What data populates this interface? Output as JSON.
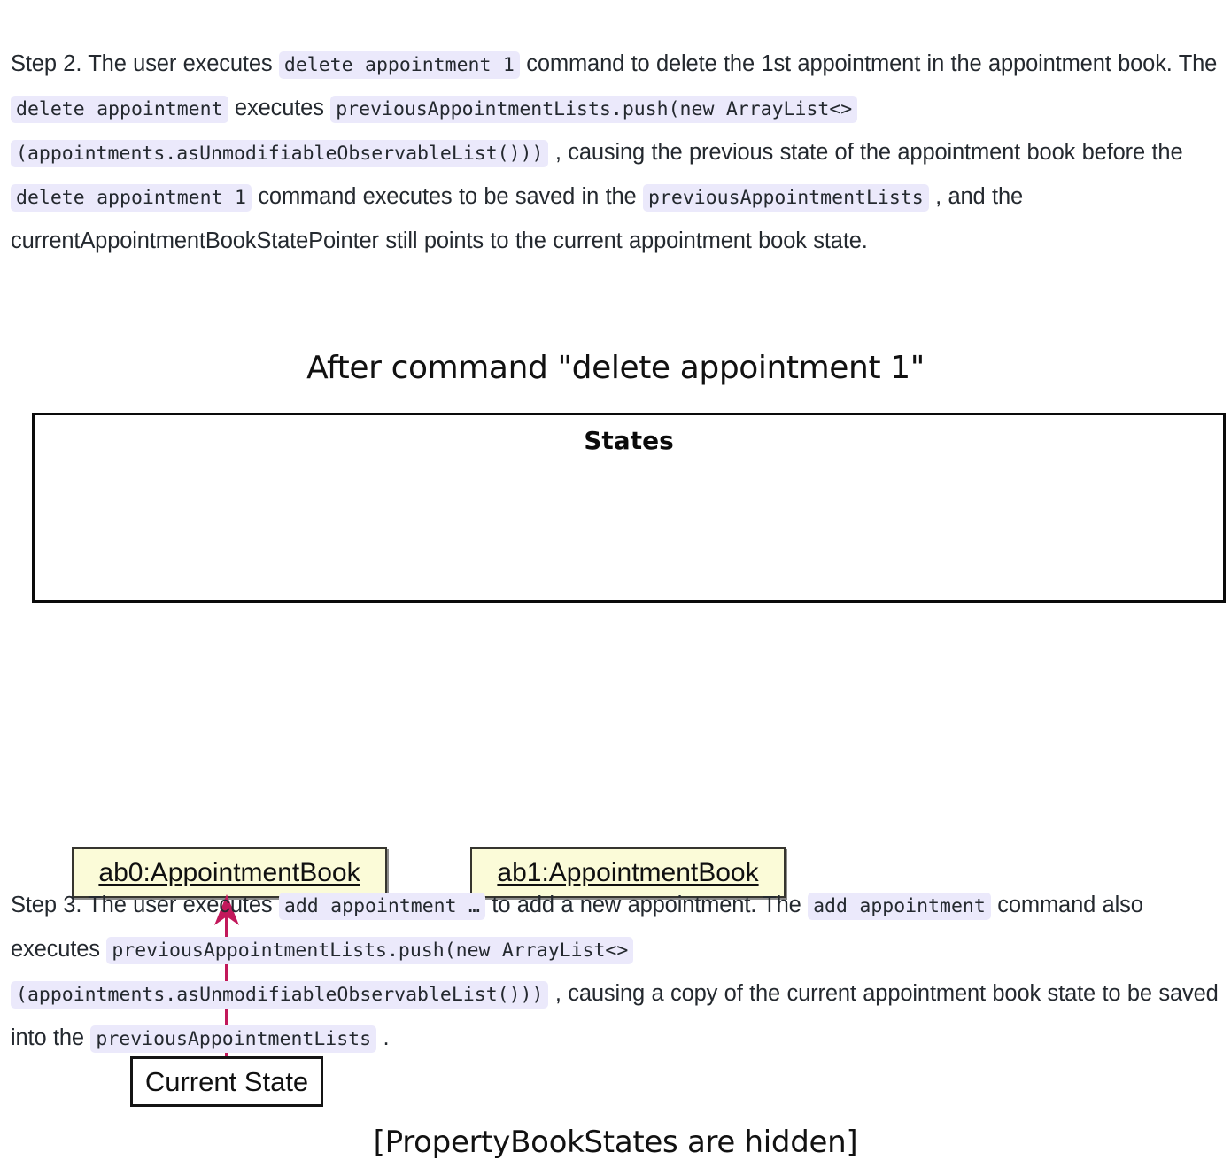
{
  "step2": {
    "name": "Step 2 paragraph",
    "segments": [
      {
        "type": "text",
        "value": "Step 2. The user executes "
      },
      {
        "type": "code",
        "value": "delete appointment 1"
      },
      {
        "type": "text",
        "value": " command to delete the 1st appointment in the appointment book. The "
      },
      {
        "type": "code",
        "value": "delete appointment"
      },
      {
        "type": "text",
        "value": " executes "
      },
      {
        "type": "code",
        "value": "previousAppointmentLists.push(new ArrayList<>"
      },
      {
        "type": "break",
        "value": ""
      },
      {
        "type": "code",
        "value": "(appointments.asUnmodifiableObservableList()))"
      },
      {
        "type": "text",
        "value": " , causing the previous state of the appointment book before the "
      },
      {
        "type": "code",
        "value": "delete appointment 1"
      },
      {
        "type": "text",
        "value": " command executes to be saved in the "
      },
      {
        "type": "code",
        "value": "previousAppointmentLists"
      },
      {
        "type": "text",
        "value": " , and the currentAppointmentBookStatePointer still points to the current appointment book state."
      }
    ]
  },
  "diagram": {
    "title": "After command \"delete appointment 1\"",
    "frame_label": "States",
    "objects": [
      {
        "id": "ab0",
        "label": "ab0:AppointmentBook"
      },
      {
        "id": "ab1",
        "label": "ab1:AppointmentBook"
      }
    ],
    "pointer_label": "Current State",
    "caption": "[PropertyBookStates are hidden]",
    "colors": {
      "object_fill": "#fbfbd8",
      "object_border": "#36352f",
      "frame_border": "#0a0a0a",
      "arrow": "#c2185b",
      "text": "#101010"
    }
  },
  "step3": {
    "name": "Step 3 paragraph",
    "segments": [
      {
        "type": "text",
        "value": "Step 3. The user executes "
      },
      {
        "type": "code",
        "value": "add appointment …"
      },
      {
        "type": "text",
        "value": " to add a new appointment. The "
      },
      {
        "type": "code",
        "value": "add appointment"
      },
      {
        "type": "text",
        "value": " command also executes "
      },
      {
        "type": "code",
        "value": "previousAppointmentLists.push(new ArrayList<>"
      },
      {
        "type": "break",
        "value": ""
      },
      {
        "type": "code",
        "value": "(appointments.asUnmodifiableObservableList()))"
      },
      {
        "type": "text",
        "value": " , causing a copy of the current appointment book state to be saved into the "
      },
      {
        "type": "code",
        "value": "previousAppointmentLists"
      },
      {
        "type": "text",
        "value": " ."
      }
    ]
  },
  "theme": {
    "code_background": "#ebe9fb",
    "page_background": "#ffffff",
    "body_text": "#24292f"
  }
}
